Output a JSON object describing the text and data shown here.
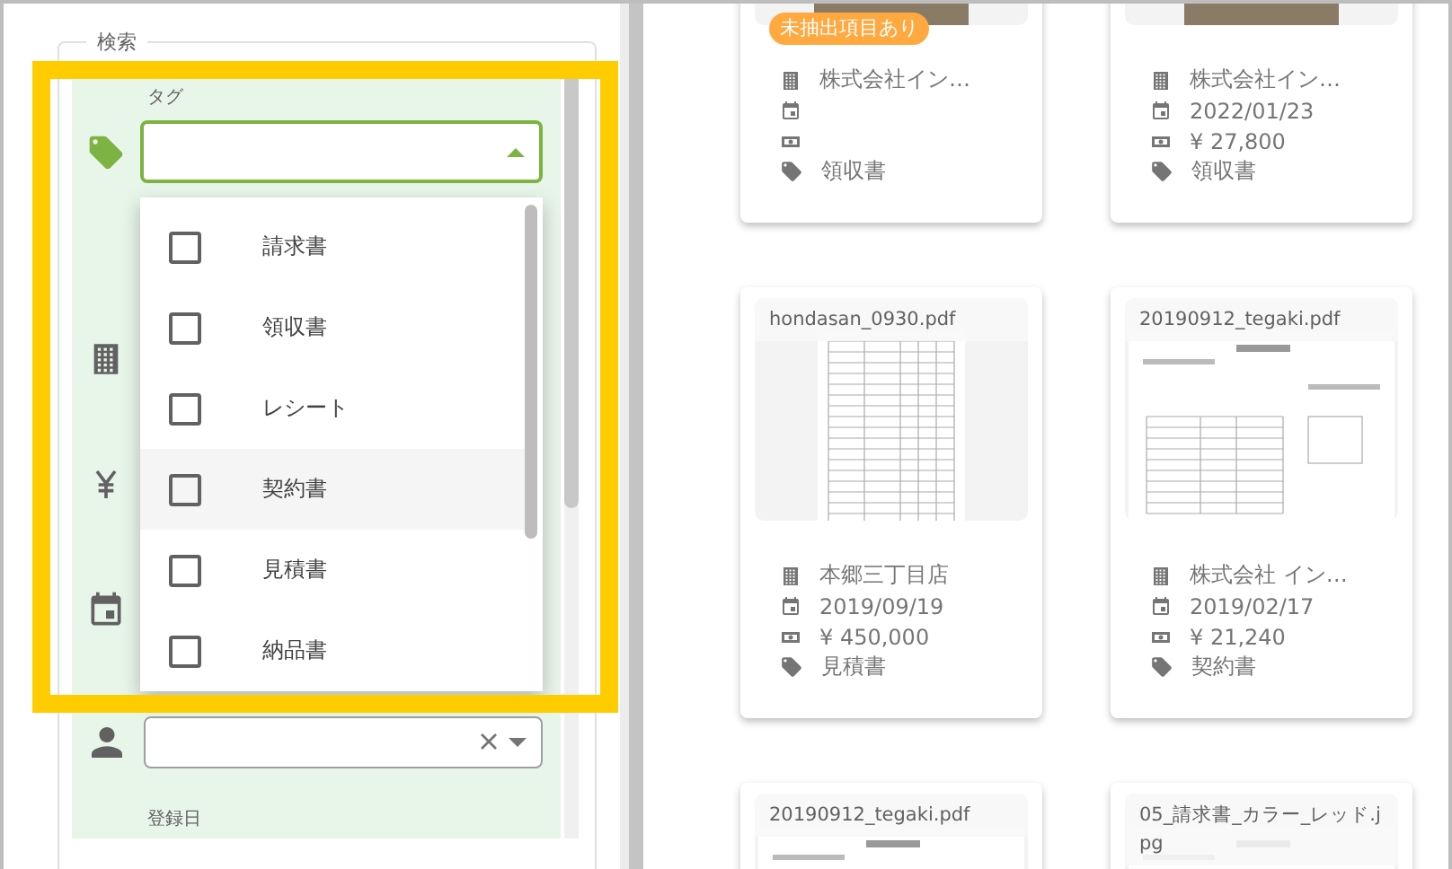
{
  "search_panel": {
    "legend": "検索",
    "tag_field": {
      "label": "タグ",
      "focused": true,
      "expanded": true
    },
    "tag_options": [
      {
        "label": "請求書",
        "checked": false,
        "highlighted": false
      },
      {
        "label": "領収書",
        "checked": false,
        "highlighted": false
      },
      {
        "label": "レシート",
        "checked": false,
        "highlighted": false
      },
      {
        "label": "契約書",
        "checked": false,
        "highlighted": true
      },
      {
        "label": "見積書",
        "checked": false,
        "highlighted": false
      },
      {
        "label": "納品書",
        "checked": false,
        "highlighted": false
      }
    ],
    "date_label": "登録日"
  },
  "documents": [
    {
      "kind": "photo",
      "badge": "未抽出項目あり",
      "company": "株式会社イン…",
      "tag": "領収書"
    },
    {
      "kind": "photo",
      "company": "株式会社イン…",
      "date": "2022/01/23",
      "amount": "¥ 27,800",
      "tag": "領収書"
    },
    {
      "kind": "table",
      "filename": "hondasan_0930.pdf",
      "company": "本郷三丁目店",
      "date": "2019/09/19",
      "amount": "¥ 450,000",
      "tag": "見積書"
    },
    {
      "kind": "form",
      "filename": "20190912_tegaki.pdf",
      "company": "株式会社 イン…",
      "date": "2019/02/17",
      "amount": "¥ 21,240",
      "tag": "契約書"
    },
    {
      "kind": "form",
      "filename": "20190912_tegaki.pdf"
    },
    {
      "kind": "form",
      "filename": "05_請求書_カラー_レッド.jpg"
    }
  ]
}
